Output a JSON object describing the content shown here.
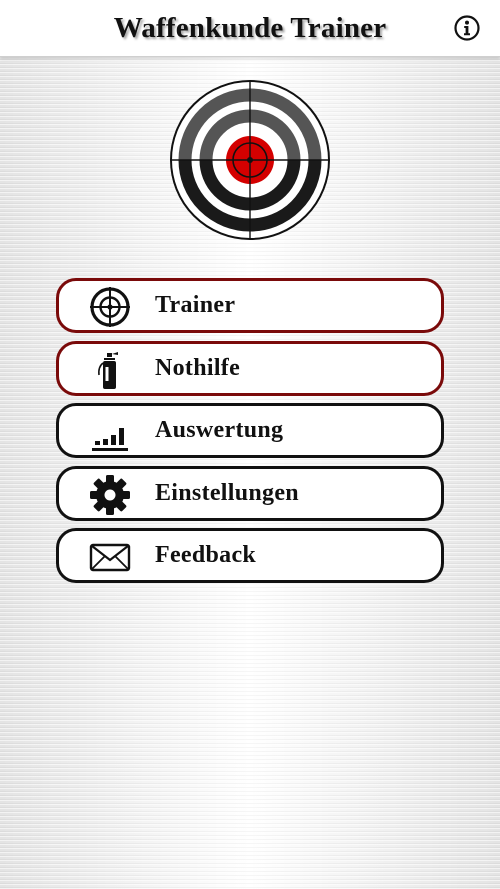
{
  "header": {
    "title": "Waffenkunde Trainer",
    "info_icon": "info-circle-icon"
  },
  "logo": {
    "icon": "shooting-target-icon",
    "colors": {
      "ring_dark": "#1a1a1a",
      "ring_gray": "#555555",
      "bullseye": "#d40000"
    }
  },
  "menu": {
    "items": [
      {
        "label": "Trainer",
        "icon": "crosshair-icon",
        "border": "#7a0a0a"
      },
      {
        "label": "Nothilfe",
        "icon": "fire-extinguisher-icon",
        "border": "#7a0a0a"
      },
      {
        "label": "Auswertung",
        "icon": "bar-chart-icon",
        "border": "#111111"
      },
      {
        "label": "Einstellungen",
        "icon": "gear-icon",
        "border": "#111111"
      },
      {
        "label": "Feedback",
        "icon": "envelope-icon",
        "border": "#111111"
      }
    ]
  }
}
